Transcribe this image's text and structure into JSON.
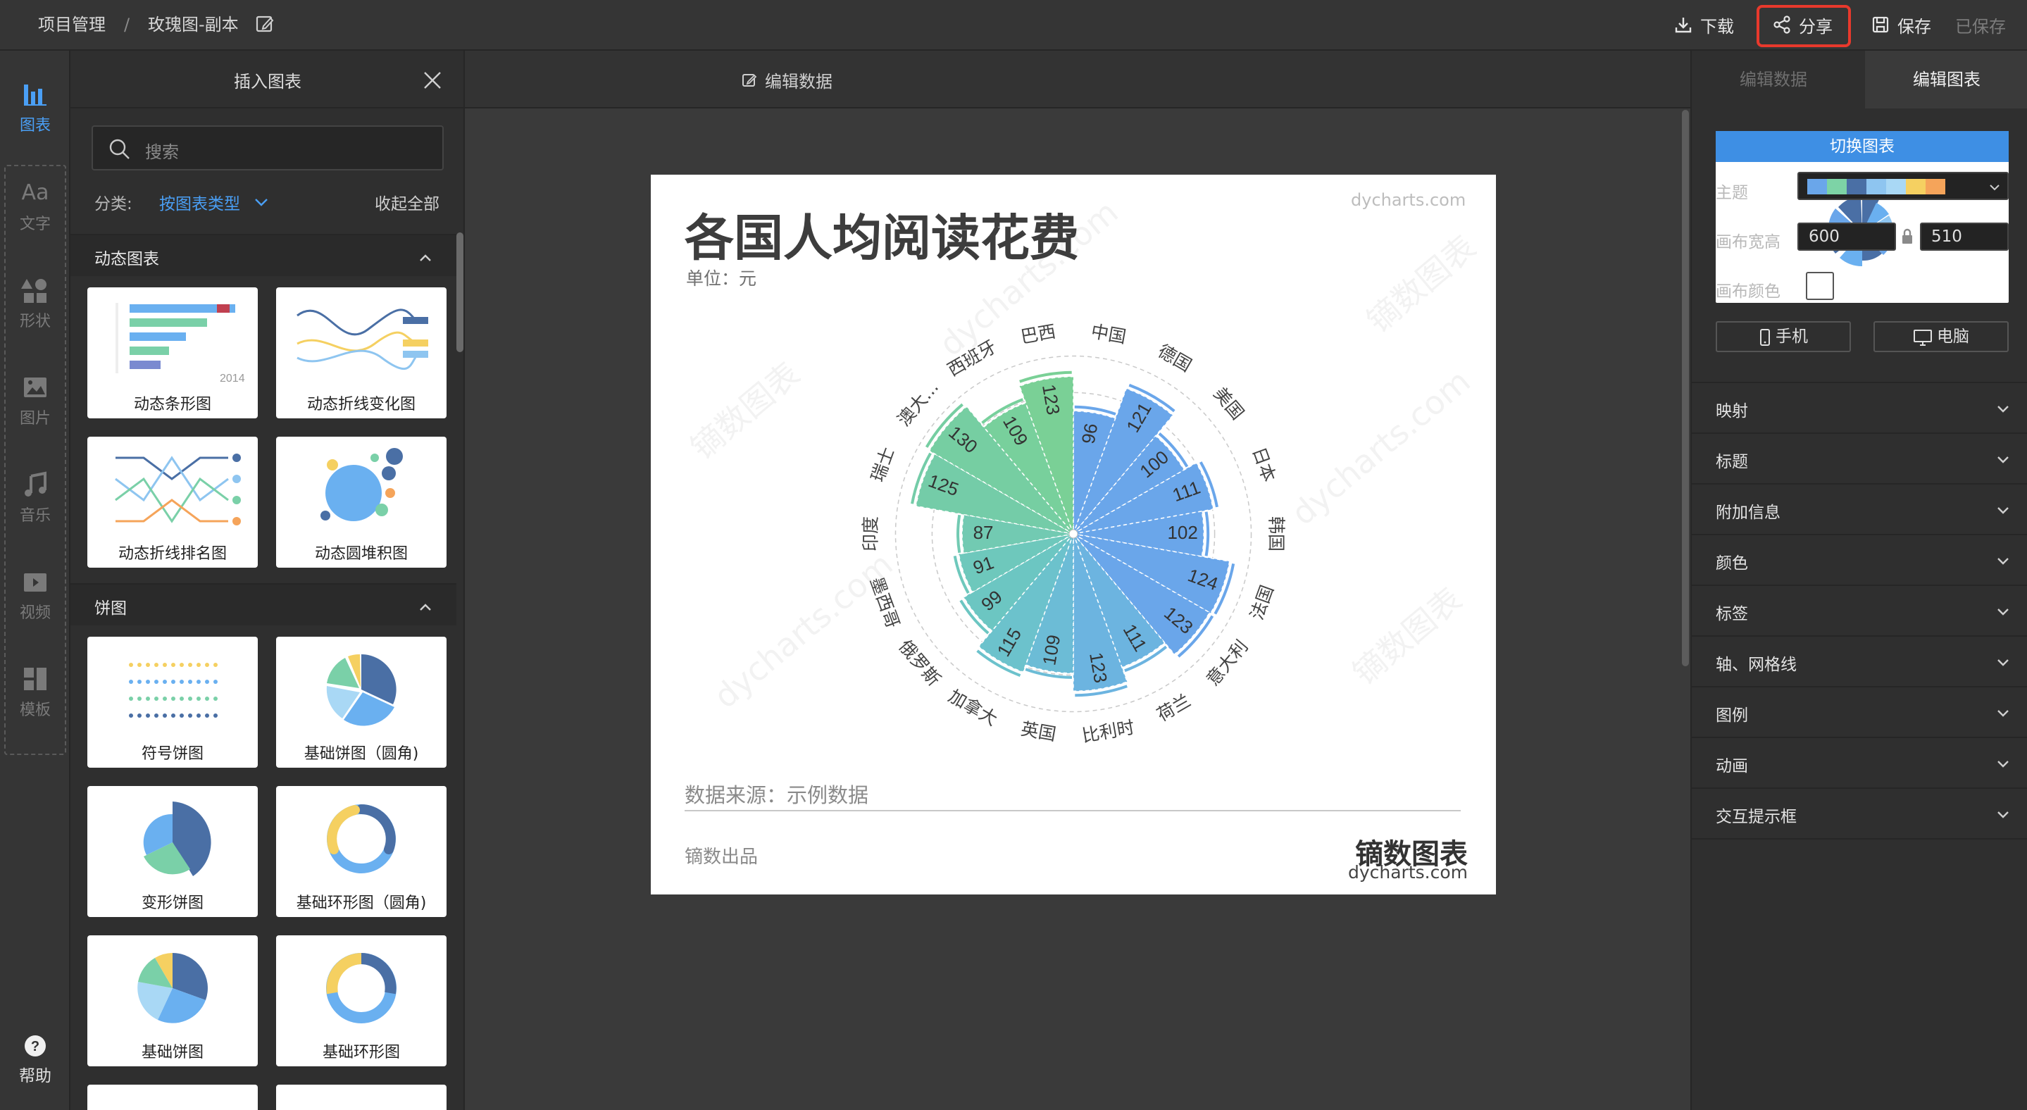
{
  "topbar": {
    "breadcrumb_root": "项目管理",
    "separator": "/",
    "doc_name": "玫瑰图-副本",
    "download": "下载",
    "share": "分享",
    "save": "保存",
    "saved_status": "已保存"
  },
  "rail": {
    "chart": "图表",
    "text": "文字",
    "shape": "形状",
    "image": "图片",
    "music": "音乐",
    "video": "视频",
    "template": "模板",
    "help": "帮助",
    "text_icon_glyph": "Aa"
  },
  "insert_panel": {
    "title": "插入图表",
    "search_placeholder": "搜索",
    "category_label": "分类:",
    "category_value": "按图表类型",
    "collapse_all": "收起全部",
    "sections": [
      {
        "name": "动态图表",
        "items": [
          "动态条形图",
          "动态折线变化图",
          "动态折线排名图",
          "动态圆堆积图"
        ]
      },
      {
        "name": "饼图",
        "items": [
          "符号饼图",
          "基础饼图（圆角)",
          "变形饼图",
          "基础环形图（圆角)",
          "基础饼图",
          "基础环形图"
        ]
      }
    ],
    "thumb_year": "2014"
  },
  "stage": {
    "edit_data": "编辑数据"
  },
  "artboard": {
    "title": "各国人均阅读花费",
    "unit": "单位：元",
    "watermark_url": "dycharts.com",
    "source": "数据来源：示例数据",
    "maker": "镝数出品",
    "brand": "镝数图表",
    "brand_url": "dycharts.com",
    "watermark_text": "镝数图表"
  },
  "chart_data": {
    "type": "rose",
    "title": "各国人均阅读花费",
    "subtitle": "单位：元",
    "categories": [
      "中国",
      "德国",
      "美国",
      "日本",
      "韩国",
      "法国",
      "意大利",
      "荷兰",
      "比利时",
      "英国",
      "加拿大",
      "俄罗斯",
      "墨西哥",
      "印度",
      "瑞士",
      "澳大...",
      "西班牙",
      "巴西"
    ],
    "values": [
      96,
      121,
      100,
      111,
      102,
      124,
      123,
      111,
      123,
      109,
      115,
      99,
      91,
      87,
      125,
      130,
      109,
      123
    ],
    "colors": [
      "#6aa6ea",
      "#6aa6ea",
      "#6aa6ea",
      "#6aa6ea",
      "#6aa6ea",
      "#6aa6ea",
      "#6aa6ea",
      "#6cb4e0",
      "#6cb4e0",
      "#6cbcd6",
      "#6cc2cc",
      "#6cc6c2",
      "#6ec8bc",
      "#72cab2",
      "#74cca8",
      "#76cea2",
      "#78d09c",
      "#7ad096"
    ],
    "ylim": [
      0,
      130
    ],
    "grid": true
  },
  "props": {
    "tab_data": "编辑数据",
    "tab_chart": "编辑图表",
    "switch_chart": "切换图表",
    "theme_label": "主题",
    "theme_colors": [
      "#6aa6ea",
      "#7dd3a6",
      "#4a6fa5",
      "#8ec5f0",
      "#a9d8f5",
      "#f5d061",
      "#f5a45a"
    ],
    "canvas_size_label": "画布宽高",
    "canvas_width": "600",
    "canvas_height": "510",
    "canvas_color_label": "画布颜色",
    "mobile": "手机",
    "desktop": "电脑",
    "sections": [
      "映射",
      "标题",
      "附加信息",
      "颜色",
      "标签",
      "轴、网格线",
      "图例",
      "动画",
      "交互提示框"
    ]
  }
}
